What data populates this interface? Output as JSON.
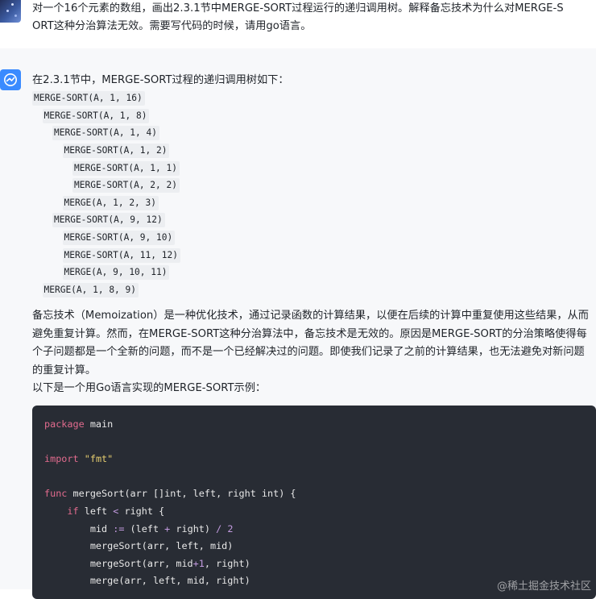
{
  "user_message": {
    "line1": "对一个16个元素的数组，画出2.3.1节中MERGE-SORT过程运行的递归调用树。解释备忘技术为什么对MERGE-S",
    "line2": "ORT这种分治算法无效。需要写代码的时候，请用go语言。"
  },
  "assistant": {
    "intro": "在2.3.1节中，MERGE-SORT过程的递归调用树如下：",
    "tree": [
      {
        "text": "MERGE-SORT(A, 1, 16)",
        "indent": 0
      },
      {
        "text": "MERGE-SORT(A, 1, 8)",
        "indent": 1
      },
      {
        "text": "MERGE-SORT(A, 1, 4)",
        "indent": 2
      },
      {
        "text": "MERGE-SORT(A, 1, 2)",
        "indent": 3
      },
      {
        "text": "MERGE-SORT(A, 1, 1)",
        "indent": 4
      },
      {
        "text": "MERGE-SORT(A, 2, 2)",
        "indent": 4
      },
      {
        "text": "MERGE(A, 1, 2, 3)",
        "indent": 3
      },
      {
        "text": "MERGE-SORT(A, 9, 12)",
        "indent": 2
      },
      {
        "text": "MERGE-SORT(A, 9, 10)",
        "indent": 3
      },
      {
        "text": "MERGE-SORT(A, 11, 12)",
        "indent": 3
      },
      {
        "text": "MERGE(A, 9, 10, 11)",
        "indent": 3
      },
      {
        "text": "MERGE(A, 1, 8, 9)",
        "indent": 1
      }
    ],
    "paragraph1": "备忘技术（Memoization）是一种优化技术，通过记录函数的计算结果，以便在后续的计算中重复使用这些结果，从而避免重复计算。然而，在MERGE-SORT这种分治算法中，备忘技术是无效的。原因是MERGE-SORT的分治策略使得每个子问题都是一个全新的问题，而不是一个已经解决过的问题。即使我们记录了之前的计算结果，也无法避免对新问题的重复计算。",
    "paragraph2": "以下是一个用Go语言实现的MERGE-SORT示例：",
    "code": [
      [
        {
          "t": "package",
          "c": "kw"
        },
        {
          "t": " main",
          "c": "fn"
        }
      ],
      [],
      [
        {
          "t": "import",
          "c": "kw"
        },
        {
          "t": " ",
          "c": "fn"
        },
        {
          "t": "\"fmt\"",
          "c": "str"
        }
      ],
      [],
      [
        {
          "t": "func",
          "c": "kw"
        },
        {
          "t": " mergeSort(arr []int, left, right int) {",
          "c": "fn"
        }
      ],
      [
        {
          "t": "    ",
          "c": "fn"
        },
        {
          "t": "if",
          "c": "kw"
        },
        {
          "t": " left ",
          "c": "fn"
        },
        {
          "t": "<",
          "c": "op"
        },
        {
          "t": " right {",
          "c": "fn"
        }
      ],
      [
        {
          "t": "        mid ",
          "c": "fn"
        },
        {
          "t": ":=",
          "c": "op"
        },
        {
          "t": " (left ",
          "c": "fn"
        },
        {
          "t": "+",
          "c": "op"
        },
        {
          "t": " right) ",
          "c": "fn"
        },
        {
          "t": "/",
          "c": "op"
        },
        {
          "t": " ",
          "c": "fn"
        },
        {
          "t": "2",
          "c": "op"
        }
      ],
      [
        {
          "t": "        mergeSort(arr, left, mid)",
          "c": "fn"
        }
      ],
      [
        {
          "t": "        mergeSort(arr, mid",
          "c": "fn"
        },
        {
          "t": "+1",
          "c": "op"
        },
        {
          "t": ", right)",
          "c": "fn"
        }
      ],
      [
        {
          "t": "        merge(arr, left, mid, right)",
          "c": "fn"
        }
      ]
    ]
  },
  "watermark": "@稀土掘金技术社区",
  "colors": {
    "code_bg": "#282c34",
    "keyword": "#e26b8e",
    "string": "#e5cd6f",
    "operator": "#c39be0",
    "avatar_bot": "#3a8bff"
  }
}
